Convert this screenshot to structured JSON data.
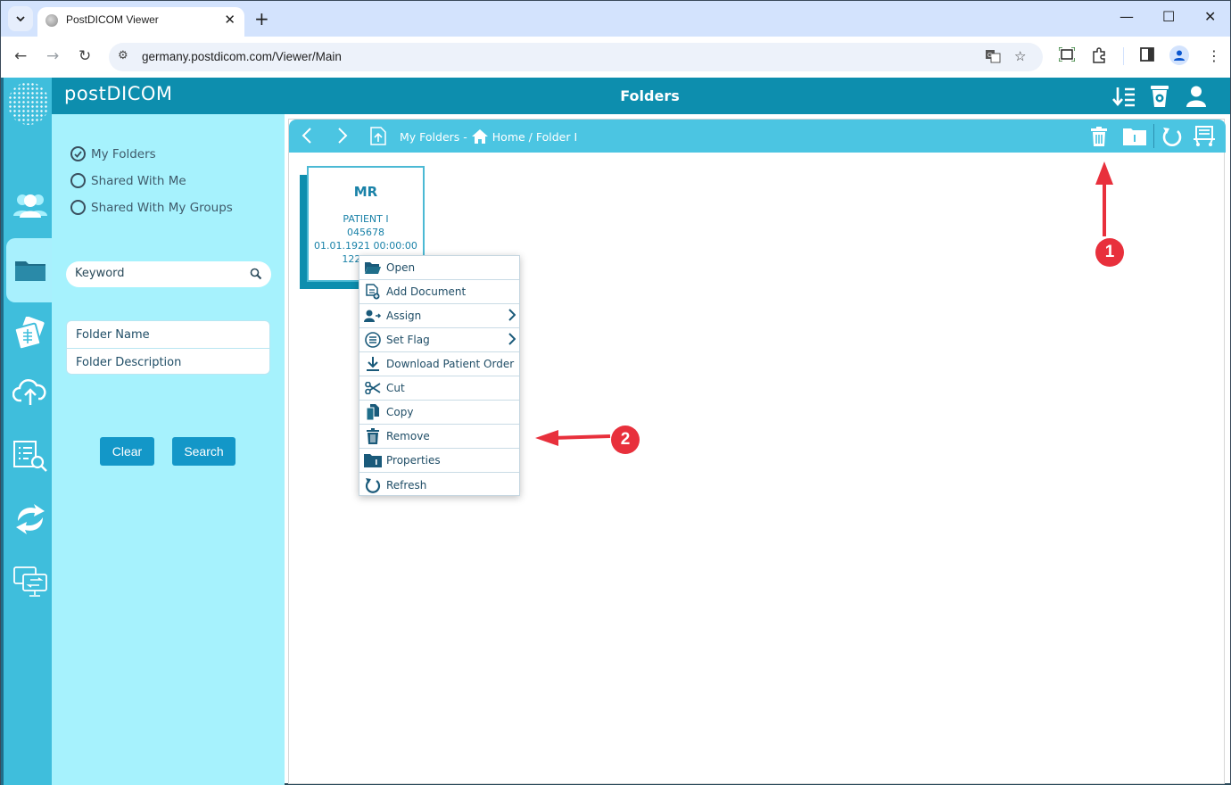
{
  "browser": {
    "tab_title": "PostDICOM Viewer",
    "url": "germany.postdicom.com/Viewer/Main"
  },
  "app": {
    "brand": "postDICOM",
    "header_title": "Folders",
    "header_icons": [
      "sort-icon",
      "recycle-bin-icon",
      "user-icon"
    ]
  },
  "rail": {
    "items": [
      {
        "name": "patients",
        "icon": "users-icon"
      },
      {
        "name": "folders",
        "icon": "folder-icon",
        "active": true
      },
      {
        "name": "studies",
        "icon": "xray-films-icon"
      },
      {
        "name": "upload",
        "icon": "cloud-upload-icon"
      },
      {
        "name": "orders",
        "icon": "list-search-icon"
      },
      {
        "name": "sync",
        "icon": "sync-icon"
      },
      {
        "name": "transfer",
        "icon": "screen-transfer-icon"
      }
    ]
  },
  "sidepanel": {
    "filters": [
      {
        "label": "My Folders",
        "checked": true
      },
      {
        "label": "Shared With Me",
        "checked": false
      },
      {
        "label": "Shared With My Groups",
        "checked": false
      }
    ],
    "keyword_placeholder": "Keyword",
    "fields": [
      "Folder Name",
      "Folder Description"
    ],
    "clear_label": "Clear",
    "search_label": "Search"
  },
  "pathbar": {
    "root": "My Folders -",
    "path": "Home / Folder I",
    "actions": [
      "delete-icon",
      "folder-info-icon",
      "refresh-icon",
      "order-cart-icon"
    ]
  },
  "card": {
    "modality": "MR",
    "patient": "PATIENT I",
    "id": "045678",
    "date": "01.01.1921 00:00:00",
    "size": "12207 KB"
  },
  "context_menu": {
    "items": [
      {
        "label": "Open",
        "icon": "folder-open-icon"
      },
      {
        "label": "Add Document",
        "icon": "add-document-icon"
      },
      {
        "label": "Assign",
        "icon": "assign-user-icon",
        "submenu": true
      },
      {
        "label": "Set Flag",
        "icon": "flag-list-icon",
        "submenu": true
      },
      {
        "label": "Download Patient Order",
        "icon": "download-icon"
      },
      {
        "label": "Cut",
        "icon": "scissors-icon"
      },
      {
        "label": "Copy",
        "icon": "copy-icon"
      },
      {
        "label": "Remove",
        "icon": "trash-icon"
      },
      {
        "label": "Properties",
        "icon": "folder-info-icon"
      },
      {
        "label": "Refresh",
        "icon": "refresh-icon"
      }
    ]
  },
  "annotations": {
    "badge1": "1",
    "badge2": "2",
    "color": "#e8303c"
  }
}
